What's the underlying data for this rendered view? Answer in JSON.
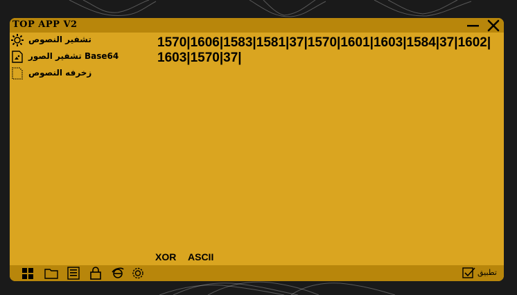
{
  "window": {
    "title": "TOP APP V2"
  },
  "sidebar": {
    "items": [
      {
        "label": "تشفير النصوص",
        "icon": "gear-icon"
      },
      {
        "label": "تشفير الصور Base64",
        "icon": "image-file-icon"
      },
      {
        "label": "زخرفه النصوص",
        "icon": "dotted-file-icon"
      }
    ]
  },
  "output": {
    "text": "1570|1606|1583|1581|37|1570|1601|1603|1584|37|1602|1603|1570|37|"
  },
  "modes": {
    "xor": "XOR",
    "ascii": "ASCII"
  },
  "bottombar": {
    "icons": [
      "windows-icon",
      "folder-icon",
      "binary-calculator-icon",
      "lock-icon",
      "browser-icon",
      "settings-icon"
    ],
    "apply_label": "تطبيق"
  },
  "colors": {
    "window_bg": "#DAA520",
    "bar_bg": "#B8860B",
    "desktop_bg": "#1a1a1a"
  }
}
